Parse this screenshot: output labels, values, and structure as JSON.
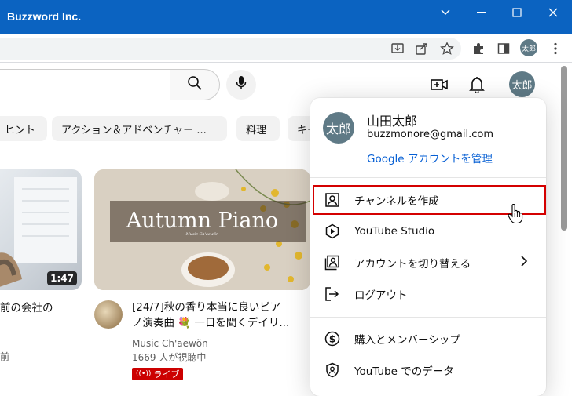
{
  "window": {
    "title": "Buzzword Inc."
  },
  "browser": {
    "profile_initials": "太郎"
  },
  "search": {
    "placeholder": ""
  },
  "header": {
    "avatar_initials": "太郎"
  },
  "chips": [
    "ヒント",
    "アクション＆アドベンチャー ...",
    "料理",
    "キー"
  ],
  "videos": [
    {
      "duration": "1:47",
      "title_line1": "前の会社の",
      "meta_line1": "前"
    },
    {
      "title_line1": "[24/7]秋の香り本当に良いピア",
      "title_line2": "ノ演奏曲 💐 一日を聞くデイリ...",
      "channel": "Music Ch'aewŏn",
      "viewers": "1669 人が視聴中",
      "live_label": "ライブ",
      "thumb_title": "Autumn Piano",
      "thumb_subtitle": "Music Ch'aewŏn"
    }
  ],
  "account_menu": {
    "avatar_initials": "太郎",
    "name": "山田太郎",
    "email": "buzzmonore@gmail.com",
    "manage_link": "Google アカウントを管理",
    "items": [
      {
        "label": "チャンネルを作成",
        "icon": "create-channel-icon"
      },
      {
        "label": "YouTube Studio",
        "icon": "studio-icon"
      },
      {
        "label": "アカウントを切り替える",
        "icon": "switch-account-icon"
      },
      {
        "label": "ログアウト",
        "icon": "sign-out-icon"
      },
      {
        "label": "購入とメンバーシップ",
        "icon": "purchases-icon"
      },
      {
        "label": "YouTube でのデータ",
        "icon": "your-data-icon"
      }
    ]
  },
  "colors": {
    "titlebar": "#0b63c1",
    "link": "#065fd4",
    "live": "#cc0000",
    "highlight": "#d40000"
  }
}
